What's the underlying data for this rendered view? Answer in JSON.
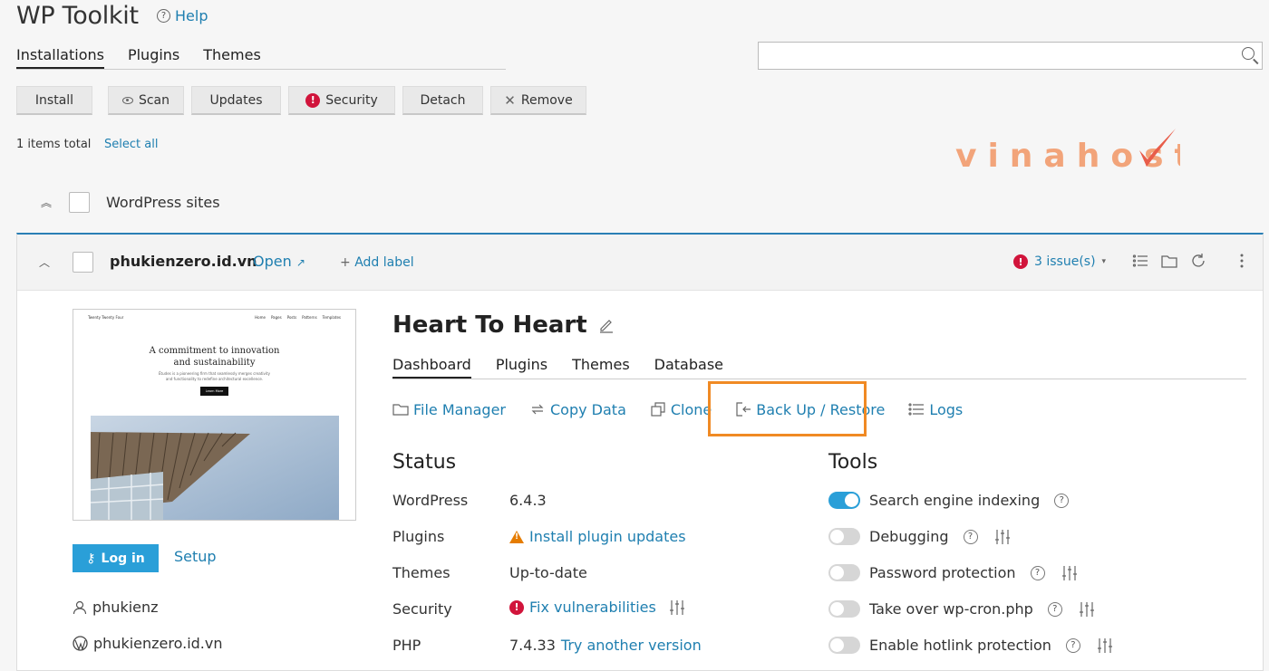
{
  "app": {
    "title": "WP Toolkit",
    "help": "Help"
  },
  "top_tabs": [
    "Installations",
    "Plugins",
    "Themes"
  ],
  "search": {
    "placeholder": ""
  },
  "toolbar": {
    "install": "Install",
    "scan": "Scan",
    "updates": "Updates",
    "security": "Security",
    "detach": "Detach",
    "remove": "Remove",
    "security_badge": "!"
  },
  "list": {
    "total": "1 items total",
    "select_all": "Select all",
    "group": "WordPress sites"
  },
  "logo": {
    "text": "vinahost"
  },
  "site": {
    "domain": "phukienzero.id.vn",
    "open": "Open",
    "add_label": "Add label",
    "issues": "3 issue(s)",
    "title": "Heart To Heart",
    "tabs": [
      "Dashboard",
      "Plugins",
      "Themes",
      "Database"
    ],
    "actions": [
      "File Manager",
      "Copy Data",
      "Clone",
      "Back Up / Restore",
      "Logs"
    ],
    "login": "Log in",
    "setup": "Setup",
    "user": "phukienz",
    "site_url": "phukienzero.id.vn",
    "preview": {
      "brand": "Twenty Twenty Four",
      "nav": [
        "Home",
        "Pages",
        "Posts",
        "Patterns",
        "Templates"
      ],
      "headline1": "A commitment to innovation",
      "headline2": "and sustainability",
      "sub1": "Études is a pioneering firm that seamlessly merges creativity",
      "sub2": "and functionality to redefine architectural excellence.",
      "button": "Learn More"
    }
  },
  "status": {
    "heading": "Status",
    "rows": [
      {
        "label": "WordPress",
        "value": "6.4.3"
      },
      {
        "label": "Plugins",
        "value": "Install plugin updates"
      },
      {
        "label": "Themes",
        "value": "Up-to-date"
      },
      {
        "label": "Security",
        "value": "Fix vulnerabilities"
      },
      {
        "label": "PHP",
        "value": "7.4.33",
        "link": "Try another version"
      }
    ]
  },
  "tools": {
    "heading": "Tools",
    "rows": [
      {
        "label": "Search engine indexing",
        "on": true
      },
      {
        "label": "Debugging",
        "on": false
      },
      {
        "label": "Password protection",
        "on": false
      },
      {
        "label": "Take over wp-cron.php",
        "on": false
      },
      {
        "label": "Enable hotlink protection",
        "on": false
      }
    ]
  },
  "colors": {
    "accent": "#1f7fb0",
    "toggle_on": "#2a9fd8",
    "danger": "#d1143b",
    "warning": "#e57c00",
    "highlight": "#f08a24",
    "logo": "#f2a47a"
  }
}
